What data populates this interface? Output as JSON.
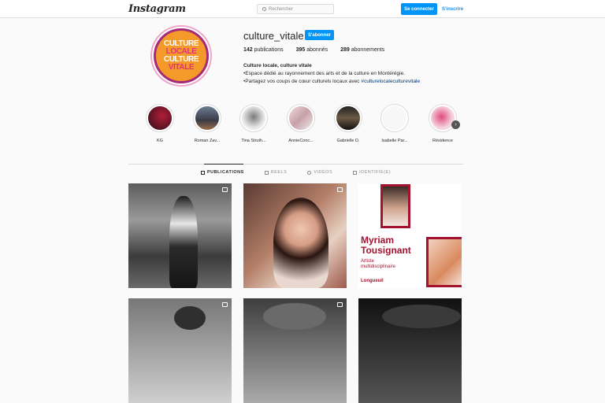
{
  "topbar": {
    "logo": "Instagram",
    "search_placeholder": "Rechercher",
    "login_label": "Se connecter",
    "signup_label": "S'inscrire"
  },
  "profile": {
    "avatar_lines": [
      "CULTURE",
      "LOCALE",
      "CULTURE",
      "VITALE"
    ],
    "username": "culture_vitale",
    "follow_label": "S'abonner",
    "stats": {
      "posts_count": "142",
      "posts_label": "publications",
      "followers_count": "395",
      "followers_label": "abonnés",
      "following_count": "289",
      "following_label": "abonnements"
    },
    "bio": {
      "name": "Culture locale, culture vitale",
      "line1": "•Espace dédié au rayonnement des arts et de la culture en Montérégie.",
      "line2_prefix": "•Partagez vos coups de cœur culturels locaux avec ",
      "line2_tag": "#culturelocaleculturevitale"
    }
  },
  "highlights": [
    {
      "label": "KG",
      "color": "#3a1b22"
    },
    {
      "label": "Roman Zav...",
      "color": "#4b5a6e"
    },
    {
      "label": "Tina Struth...",
      "color": "#d9d9d9"
    },
    {
      "label": "AnnieConc...",
      "color": "#e8c5cc"
    },
    {
      "label": "Gabrielle D.",
      "color": "#2c2c2c"
    },
    {
      "label": "Isabelle Par...",
      "color": "#f4f4f4"
    },
    {
      "label": "Résidence",
      "color": "#f1c7d6"
    }
  ],
  "tabs": [
    {
      "label": "PUBLICATIONS",
      "icon": "grid-icon",
      "active": true
    },
    {
      "label": "REELS",
      "icon": "reels-icon",
      "active": false
    },
    {
      "label": "VIDÉOS",
      "icon": "video-icon",
      "active": false
    },
    {
      "label": "IDENTIFIÉ(E)",
      "icon": "tag-icon",
      "active": false
    }
  ],
  "posts": {
    "p3_name_first": "Myriam",
    "p3_name_last": "Tousignant",
    "p3_role": "Artiste multidisciplinaire",
    "p3_city": "Longueuil"
  },
  "colors": {
    "accent": "#0095f6",
    "brand_red": "#a3122e",
    "avatar_orange": "#f39a2b",
    "avatar_pink": "#e2327f"
  }
}
